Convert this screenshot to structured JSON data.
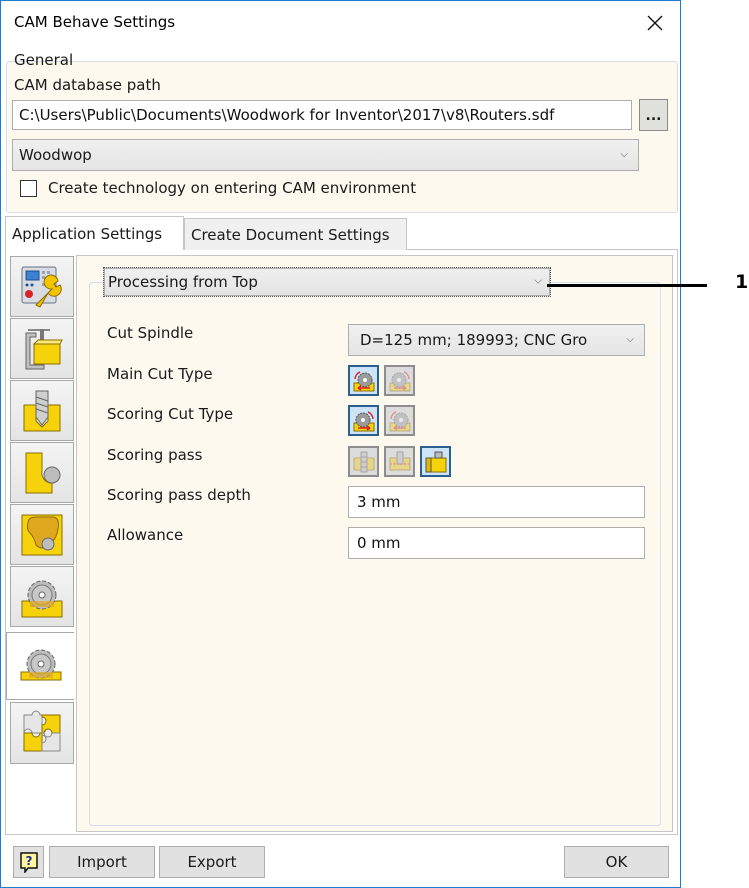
{
  "window": {
    "title": "CAM Behave Settings",
    "close_icon": "close-icon"
  },
  "general": {
    "legend": "General",
    "db_path_label": "CAM database path",
    "db_path_value": "C:\\Users\\Public\\Documents\\Woodwork for Inventor\\2017\\v8\\Routers.sdf",
    "browse_label": "...",
    "postprocessor_selected": "Woodwop",
    "create_technology_label": "Create technology on entering CAM environment",
    "create_technology_checked": false
  },
  "tabs": [
    {
      "label": "Application Settings",
      "active": true
    },
    {
      "label": "Create Document Settings",
      "active": false
    }
  ],
  "sidebar": {
    "items": [
      {
        "icon": "cnc-machine-wrench-icon",
        "selected": false
      },
      {
        "icon": "clamp-workpiece-icon",
        "selected": false
      },
      {
        "icon": "drill-pocket-icon",
        "selected": false
      },
      {
        "icon": "contour-milling-icon",
        "selected": false
      },
      {
        "icon": "area-milling-icon",
        "selected": false
      },
      {
        "icon": "saw-blade-groove-icon",
        "selected": false
      },
      {
        "icon": "saw-blade-cut-icon",
        "selected": true
      },
      {
        "icon": "puzzle-plugins-icon",
        "selected": false
      }
    ]
  },
  "section": {
    "selected": "Processing from Top",
    "callout_number": "1"
  },
  "fields": {
    "cut_spindle": {
      "label": "Cut Spindle",
      "value": "D=125 mm; 189993; CNC Gro"
    },
    "main_cut_type": {
      "label": "Main Cut Type",
      "options": [
        "climb-cut-icon",
        "conventional-cut-icon"
      ],
      "selected_index": 0
    },
    "scoring_cut_type": {
      "label": "Scoring Cut Type",
      "options": [
        "climb-cut-icon",
        "conventional-cut-icon"
      ],
      "selected_index": 0
    },
    "scoring_pass": {
      "label": "Scoring pass",
      "options": [
        "scoring-none-icon",
        "scoring-middle-icon",
        "scoring-side-icon"
      ],
      "selected_index": 2
    },
    "scoring_pass_depth": {
      "label": "Scoring pass depth",
      "value": "3 mm"
    },
    "allowance": {
      "label": "Allowance",
      "value": "0 mm"
    }
  },
  "footer": {
    "help_icon": "help-icon",
    "import_label": "Import",
    "export_label": "Export",
    "ok_label": "OK"
  },
  "colors": {
    "window_border": "#1e7bd4",
    "panel_background": "#fdf9ef",
    "selected_toggle": "#cde4f7",
    "icon_yellow": "#f5d20a"
  }
}
